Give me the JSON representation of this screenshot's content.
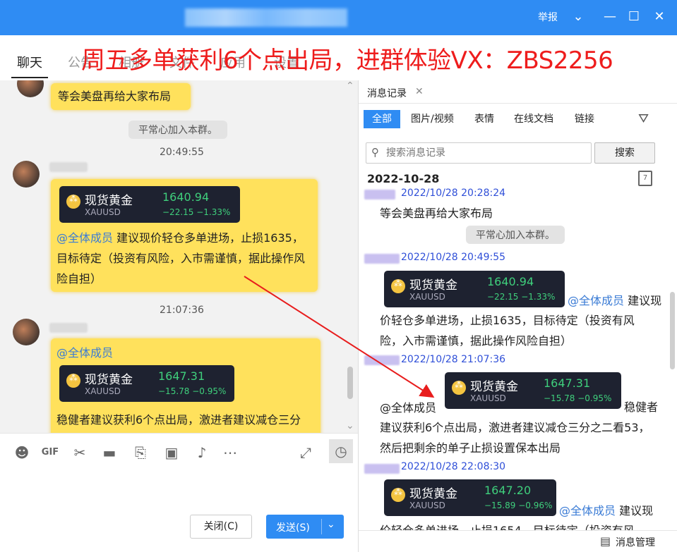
{
  "window": {
    "report_label": "举报"
  },
  "tabs": [
    "聊天",
    "公告",
    "相册",
    "文件",
    "应用",
    "设置"
  ],
  "banner": {
    "text": "周五多单获利6个点出局，进群体验VX：ZBS2256"
  },
  "chat": {
    "msg1_text": "等会美盘再给大家布局",
    "sys_join": "平常心加入本群。",
    "time1": "20:49:55",
    "card1": {
      "name": "现货黄金",
      "symbol": "XAUUSD",
      "price": "1640.94",
      "change": "−22.15   −1.33%"
    },
    "msg2_at": "@全体成员",
    "msg2_text": " 建议现价轻仓多单进场，止损1635，目标待定（投资有风险，入市需谨慎，据此操作风险自担）",
    "time2": "21:07:36",
    "msg3_at": "@全体成员",
    "card2": {
      "name": "现货黄金",
      "symbol": "XAUUSD",
      "price": "1647.31",
      "change": "−15.78   −0.95%"
    },
    "msg3_text": "稳健者建议获利6个点出局，激进者建议减仓三分"
  },
  "buttons": {
    "close": "关闭(C)",
    "send": "发送(S)"
  },
  "history": {
    "tab_label": "消息记录",
    "filters": [
      "全部",
      "图片/视频",
      "表情",
      "在线文档",
      "链接"
    ],
    "search_placeholder": "搜索消息记录",
    "search_button": "搜索",
    "date": "2022-10-28",
    "entries": [
      {
        "meta": "2022/10/28 20:28:24",
        "text": "等会美盘再给大家布局"
      },
      {
        "pill": "平常心加入本群。"
      },
      {
        "meta": "2022/10/28 20:49:55",
        "card": {
          "name": "现货黄金",
          "symbol": "XAUUSD",
          "price": "1640.94",
          "change": "−22.15   −1.33%"
        },
        "at": "@全体成员",
        "text_a": " 建议现",
        "text_b": "价轻仓多单进场，止损1635，目标待定（投资有风",
        "text_c": "险，入市需谨慎，据此操作风险自担）"
      },
      {
        "meta": "2022/10/28 21:07:36",
        "at": "@全体成员",
        "card": {
          "name": "现货黄金",
          "symbol": "XAUUSD",
          "price": "1647.31",
          "change": "−15.78   −0.95%"
        },
        "text_a": "稳健者",
        "text_b": "建议获利6个点出局，激进者建议减仓三分之二看53，",
        "text_c": "然后把剩余的单子止损设置保本出局"
      },
      {
        "meta": "2022/10/28 22:08:30",
        "card": {
          "name": "现货黄金",
          "symbol": "XAUUSD",
          "price": "1647.20",
          "change": "−15.89   −0.96%"
        },
        "at": "@全体成员",
        "text_a": " 建议现",
        "text_b": "价轻仓多单进场，止损1654，目标待定（投资有风"
      }
    ],
    "manage_label": "消息管理"
  }
}
